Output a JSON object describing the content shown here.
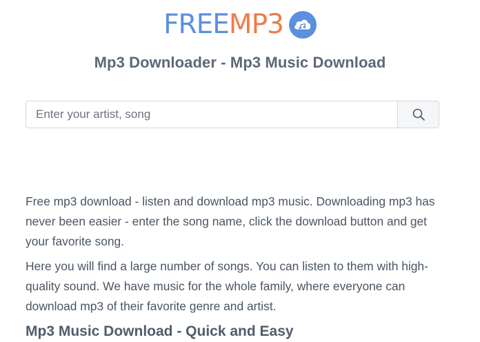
{
  "logo": {
    "free_text": "FREE",
    "mp3_text": "MP3",
    "icon": "cloud-music-icon",
    "colors": {
      "free": "#5b8fe0",
      "mp3": "#f07a4a",
      "icon": "#5b8fe0"
    }
  },
  "header": {
    "subtitle": "Mp3 Downloader - Mp3 Music Download"
  },
  "search": {
    "placeholder": "Enter your artist, song",
    "value": "",
    "button_icon": "search-icon"
  },
  "main": {
    "paragraphs": [
      "Free mp3 download - listen and download mp3 music. Downloading mp3 has never been easier - enter the song name, click the download button and get your favorite song.",
      "Here you will find a large number of songs. You can listen to them with high-quality sound. We have music for the whole family, where everyone can download mp3 of their favorite genre and artist."
    ],
    "heading": "Mp3 Music Download - Quick and Easy"
  }
}
